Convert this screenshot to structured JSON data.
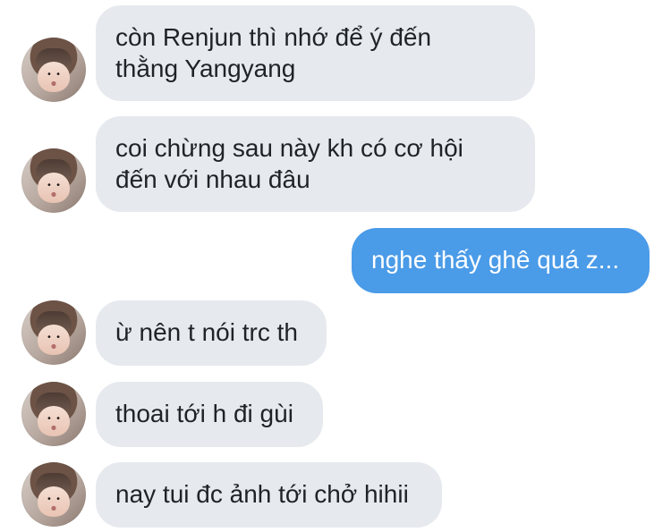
{
  "conversation": {
    "messages": [
      {
        "direction": "incoming",
        "text": "còn Renjun thì nhớ để ý đến\nthằng Yangyang"
      },
      {
        "direction": "incoming",
        "text": "coi chừng sau này kh có cơ hội\nđến với nhau đâu"
      },
      {
        "direction": "outgoing",
        "text": "nghe thấy ghê quá z..."
      },
      {
        "direction": "incoming",
        "text": "ừ nên t nói trc th"
      },
      {
        "direction": "incoming",
        "text": "thoai tới h đi gùi"
      },
      {
        "direction": "incoming",
        "text": "nay tui đc ảnh tới chở hihii"
      }
    ]
  },
  "colors": {
    "incoming_bubble": "#e6e9ee",
    "outgoing_bubble": "#4a9be8",
    "incoming_text": "#1f2328",
    "outgoing_text": "#ffffff"
  }
}
